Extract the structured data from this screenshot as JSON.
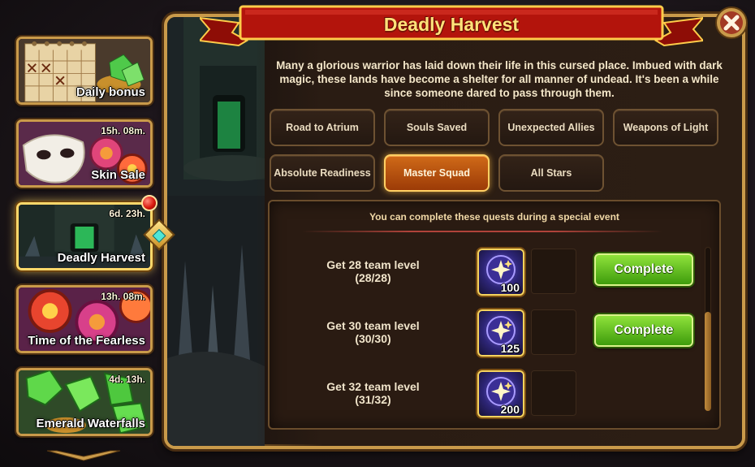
{
  "sidebar": {
    "items": [
      {
        "title": "Daily bonus",
        "timer": ""
      },
      {
        "title": "Skin Sale",
        "timer": "15h. 08m."
      },
      {
        "title": "Deadly Harvest",
        "timer": "6d. 23h."
      },
      {
        "title": "Time of the Fearless",
        "timer": "13h. 08m."
      },
      {
        "title": "Emerald Waterfalls",
        "timer": "4d. 13h."
      }
    ]
  },
  "header": {
    "title": "Deadly Harvest",
    "description": "Many a glorious warrior has laid down their life in this cursed place. Imbued with dark magic, these lands have become a shelter for all manner of undead. It's been a while since someone dared to pass through them."
  },
  "tabs": [
    {
      "label": "Road to Atrium"
    },
    {
      "label": "Souls Saved"
    },
    {
      "label": "Unexpected Allies"
    },
    {
      "label": "Weapons of Light"
    },
    {
      "label": "Absolute Readiness"
    },
    {
      "label": "Master Squad"
    },
    {
      "label": "All Stars"
    }
  ],
  "active_tab": "Master Squad",
  "quests": {
    "note": "You can complete these quests during a special event",
    "rows": [
      {
        "task": "Get 28 team level",
        "progress": "(28/28)",
        "reward": "100",
        "button": "Complete"
      },
      {
        "task": "Get 30 team level",
        "progress": "(30/30)",
        "reward": "125",
        "button": "Complete"
      },
      {
        "task": "Get 32 team level",
        "progress": "(31/32)",
        "reward": "200",
        "button": ""
      }
    ]
  },
  "colors": {
    "frame_gold": "#c99a4a",
    "banner_red": "#b3140c",
    "title_yellow": "#ffe27a",
    "active_tab_orange": "#c0560f",
    "complete_green": "#5cbc1b",
    "notification_red": "#d8190e"
  },
  "icons": {
    "close": "close-x-icon",
    "reward": "star-orb-icon",
    "scroll": "chevron-down-icon"
  }
}
